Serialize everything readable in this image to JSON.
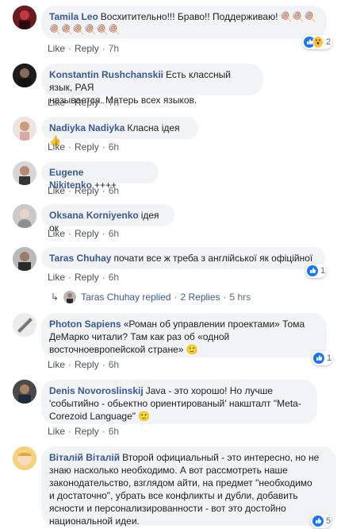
{
  "comments": [
    {
      "author": "Tamila Leo",
      "text": "Восхитительно!!! Браво!! Поддерживаю! 🍭🍭🍭",
      "text2": "🍭🍭🍭🍭🍭🍭",
      "like": "Like",
      "reply": "Reply",
      "time": "7h",
      "reactions": "2"
    },
    {
      "author": "Konstantin Rushchanskii",
      "text": "Есть классный язык, РАЯ",
      "text2": "называется. Матерь всех языков.",
      "like": "Like",
      "reply": "Reply",
      "time": "7h"
    },
    {
      "author": "Nadiyka Nadiyka",
      "text": "Класна ідея 👍",
      "like": "Like",
      "reply": "Reply",
      "time": "6h"
    },
    {
      "author": "Eugene Nikitenko",
      "text": "++++",
      "like": "Like",
      "reply": "Reply",
      "time": "6h"
    },
    {
      "author": "Oksana Korniyenko",
      "text": "ідея ок",
      "like": "Like",
      "reply": "Reply",
      "time": "6h"
    },
    {
      "author": "Taras Chuhay",
      "text": "почати все ж треба з англійської як офіційної",
      "like": "Like",
      "reply": "Reply",
      "time": "6h",
      "reactions": "1",
      "replies": {
        "name": "Taras Chuhay replied",
        "count": "2 Replies",
        "time": "5 hrs"
      }
    },
    {
      "author": "Photon Sapiens",
      "text": "«Роман об управлении проектами» Тома",
      "text2": "ДеМарко читали? Там как раз об «одной",
      "text3": "восточноевропейской стране» 🙂",
      "like": "Like",
      "reply": "Reply",
      "time": "6h",
      "reactions": "1"
    },
    {
      "author": "Denis Novoroslinskij",
      "text": "Java - это хорошо! Но лучше",
      "text2": "'событийно - обьектно ориентированый' накшталт \"Meta-",
      "text3": "Corezoid Language\" 🙂",
      "like": "Like",
      "reply": "Reply",
      "time": "6h"
    },
    {
      "author": "Віталій Віталій",
      "text": "Второй официальный - это интересно, но не",
      "text2": "знаю насколько необходимо. А вот рассмотреть наше",
      "text3": "законодательство, взглядом айти, на предмет \"необходимо",
      "text4": "и достаточно\", убрать все конфликты и дубли, добавить",
      "text5": "ясности и персонализированности - вот это достойно",
      "text6": "национальной идеи.",
      "reactions": "5"
    }
  ]
}
